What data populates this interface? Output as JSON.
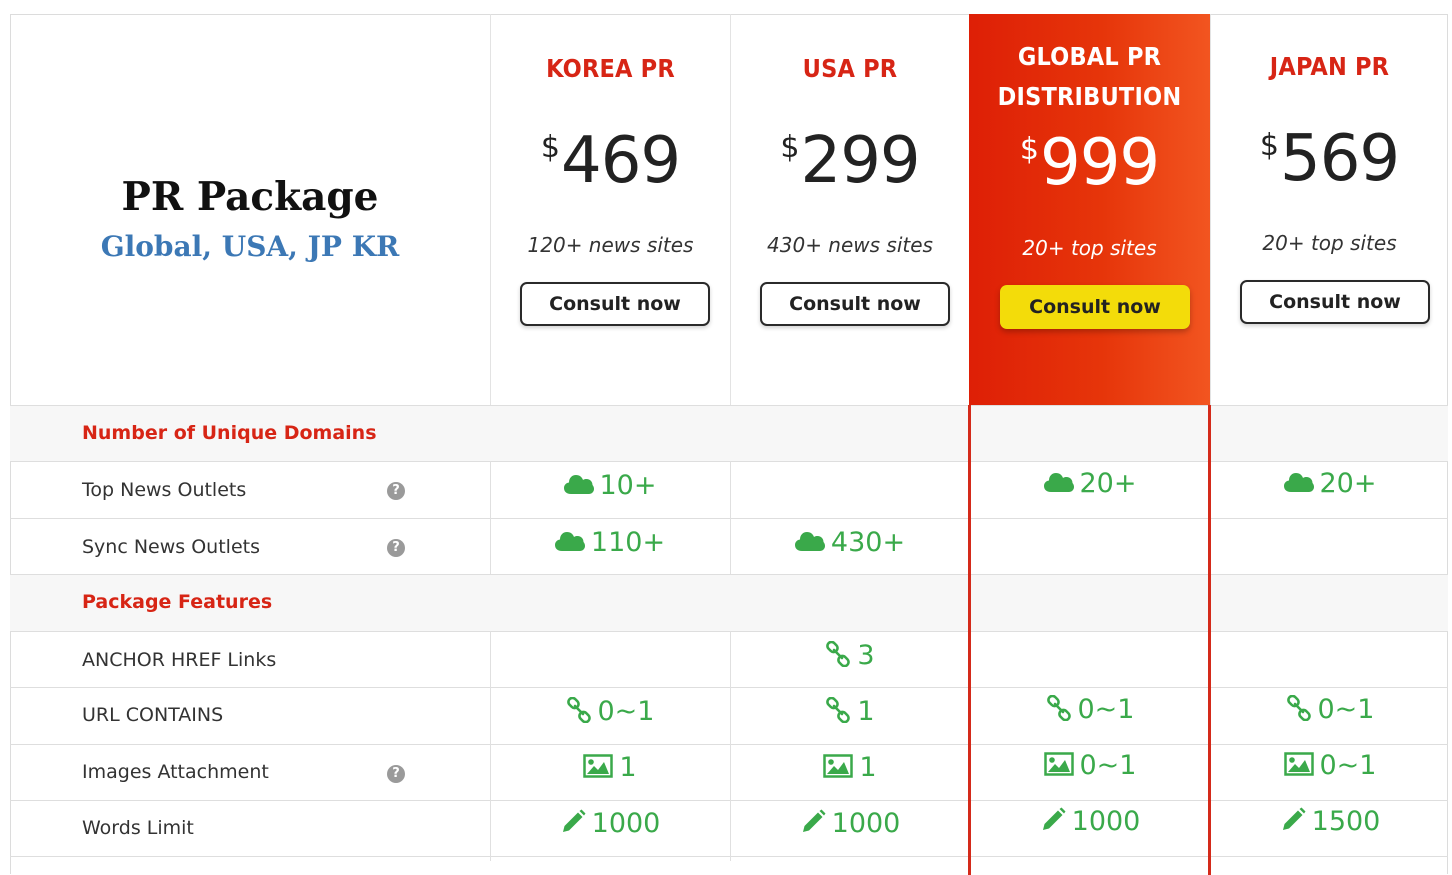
{
  "package": {
    "title": "PR Package",
    "subtitle": "Global, USA, JP KR"
  },
  "plans": [
    {
      "name": "KOREA PR",
      "currency": "$",
      "price": "469",
      "sites": "120+ news sites",
      "cta": "Consult now"
    },
    {
      "name": "USA PR",
      "currency": "$",
      "price": "299",
      "sites": "430+ news sites",
      "cta": "Consult now"
    },
    {
      "name_line1": "GLOBAL PR",
      "name_line2": "DISTRIBUTION",
      "currency": "$",
      "price": "999",
      "sites": "20+ top sites",
      "cta": "Consult now",
      "highlighted": true
    },
    {
      "name": "JAPAN PR",
      "currency": "$",
      "price": "569",
      "sites": "20+ top sites",
      "cta": "Consult now"
    }
  ],
  "sections": {
    "domains": "Number of Unique Domains",
    "features": "Package Features"
  },
  "rows": {
    "top_news": {
      "label": "Top News Outlets",
      "icon": "cloud-icon",
      "values": [
        "10+",
        "",
        "20+",
        "20+"
      ]
    },
    "sync_news": {
      "label": "Sync News Outlets",
      "icon": "cloud-icon",
      "values": [
        "110+",
        "430+",
        "",
        ""
      ]
    },
    "anchor": {
      "label": "ANCHOR HREF Links",
      "icon": "link-icon",
      "values": [
        "",
        "3",
        "",
        ""
      ]
    },
    "url": {
      "label": "URL CONTAINS",
      "icon": "link-icon",
      "values": [
        "0~1",
        "1",
        "0~1",
        "0~1"
      ]
    },
    "images": {
      "label": "Images Attachment",
      "icon": "image-icon",
      "values": [
        "1",
        "1",
        "0~1",
        "0~1"
      ]
    },
    "words": {
      "label": "Words Limit",
      "icon": "pencil-icon",
      "values": [
        "1000",
        "1000",
        "1000",
        "1500"
      ]
    }
  },
  "help_glyph": "?",
  "colors": {
    "accent_red": "#d72515",
    "highlight_gradient_start": "#de1f06",
    "highlight_gradient_end": "#f25520",
    "cta_yellow": "#f3dc0a",
    "value_green": "#3aa94a",
    "subtitle_blue": "#3c78b5"
  }
}
